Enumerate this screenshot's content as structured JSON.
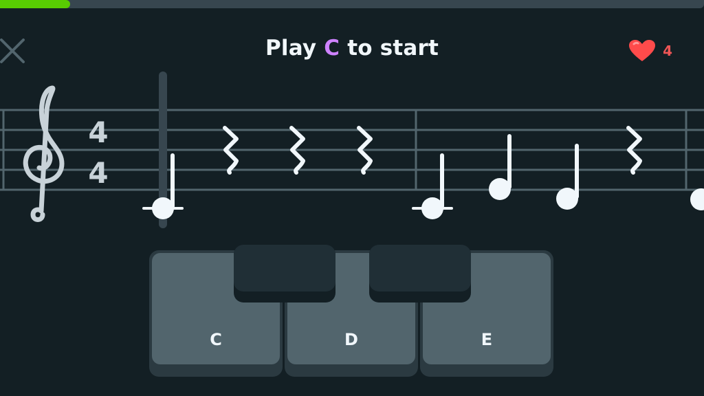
{
  "progress": {
    "fraction": 0.1
  },
  "header": {
    "title_before": "Play",
    "title_note": "C",
    "title_after": "to start",
    "hearts_count": "4"
  },
  "icons": {
    "close": "close-icon",
    "heart": "heart-icon",
    "treble_clef": "treble-clef-icon"
  },
  "staff": {
    "time_signature_top": "4",
    "time_signature_bottom": "4"
  },
  "keyboard": {
    "white_keys": [
      {
        "label": "C"
      },
      {
        "label": "D"
      },
      {
        "label": "E"
      }
    ]
  },
  "colors": {
    "background": "#131f24",
    "progress": "#58cc02",
    "accent_note": "#ce82ff",
    "heart": "#ff4b4b",
    "key_face": "#52656d"
  }
}
